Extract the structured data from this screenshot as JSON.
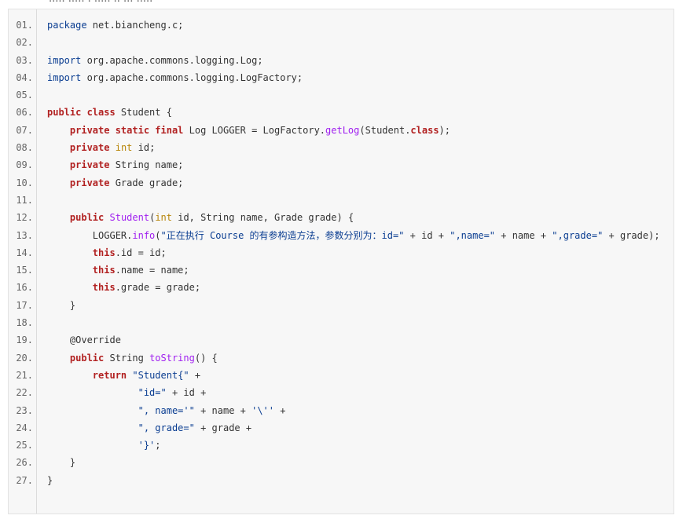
{
  "header": {
    "cut_text": "..... ..... . ..... .. ... ....."
  },
  "code_block": {
    "lines": [
      {
        "number": "01.",
        "tokens": [
          {
            "type": "string",
            "text": "package"
          },
          {
            "type": "plain",
            "text": " net.biancheng.c;"
          }
        ]
      },
      {
        "number": "02.",
        "tokens": [
          {
            "type": "plain",
            "text": ""
          }
        ]
      },
      {
        "number": "03.",
        "tokens": [
          {
            "type": "import",
            "text": "import"
          },
          {
            "type": "plain",
            "text": " org.apache.commons.logging.Log;"
          }
        ]
      },
      {
        "number": "04.",
        "tokens": [
          {
            "type": "import",
            "text": "import"
          },
          {
            "type": "plain",
            "text": " org.apache.commons.logging.LogFactory;"
          }
        ]
      },
      {
        "number": "05.",
        "tokens": [
          {
            "type": "plain",
            "text": ""
          }
        ]
      },
      {
        "number": "06.",
        "tokens": [
          {
            "type": "keyword",
            "text": "public class"
          },
          {
            "type": "plain",
            "text": " Student {"
          }
        ]
      },
      {
        "number": "07.",
        "tokens": [
          {
            "type": "plain",
            "text": "    "
          },
          {
            "type": "keyword",
            "text": "private static final"
          },
          {
            "type": "plain",
            "text": " Log LOGGER = LogFactory."
          },
          {
            "type": "method",
            "text": "getLog"
          },
          {
            "type": "plain",
            "text": "(Student."
          },
          {
            "type": "keyword",
            "text": "class"
          },
          {
            "type": "plain",
            "text": ");"
          }
        ]
      },
      {
        "number": "08.",
        "tokens": [
          {
            "type": "plain",
            "text": "    "
          },
          {
            "type": "keyword",
            "text": "private"
          },
          {
            "type": "plain",
            "text": " "
          },
          {
            "type": "type",
            "text": "int"
          },
          {
            "type": "plain",
            "text": " id;"
          }
        ]
      },
      {
        "number": "09.",
        "tokens": [
          {
            "type": "plain",
            "text": "    "
          },
          {
            "type": "keyword",
            "text": "private"
          },
          {
            "type": "plain",
            "text": " String name;"
          }
        ]
      },
      {
        "number": "10.",
        "tokens": [
          {
            "type": "plain",
            "text": "    "
          },
          {
            "type": "keyword",
            "text": "private"
          },
          {
            "type": "plain",
            "text": " Grade grade;"
          }
        ]
      },
      {
        "number": "11.",
        "tokens": [
          {
            "type": "plain",
            "text": ""
          }
        ]
      },
      {
        "number": "12.",
        "tokens": [
          {
            "type": "plain",
            "text": "    "
          },
          {
            "type": "keyword",
            "text": "public"
          },
          {
            "type": "plain",
            "text": " "
          },
          {
            "type": "method",
            "text": "Student"
          },
          {
            "type": "plain",
            "text": "("
          },
          {
            "type": "type",
            "text": "int"
          },
          {
            "type": "plain",
            "text": " id, String name, Grade grade) {"
          }
        ]
      },
      {
        "number": "13.",
        "tokens": [
          {
            "type": "plain",
            "text": "        LOGGER."
          },
          {
            "type": "method",
            "text": "info"
          },
          {
            "type": "plain",
            "text": "("
          },
          {
            "type": "string",
            "text": "\"正在执行 Course 的有参构造方法，参数分别为：id=\""
          },
          {
            "type": "plain",
            "text": " + id + "
          },
          {
            "type": "string",
            "text": "\",name=\""
          },
          {
            "type": "plain",
            "text": " + name + "
          },
          {
            "type": "string",
            "text": "\",grade=\""
          },
          {
            "type": "plain",
            "text": " + grade);"
          }
        ]
      },
      {
        "number": "14.",
        "tokens": [
          {
            "type": "plain",
            "text": "        "
          },
          {
            "type": "keyword",
            "text": "this"
          },
          {
            "type": "plain",
            "text": ".id = id;"
          }
        ]
      },
      {
        "number": "15.",
        "tokens": [
          {
            "type": "plain",
            "text": "        "
          },
          {
            "type": "keyword",
            "text": "this"
          },
          {
            "type": "plain",
            "text": ".name = name;"
          }
        ]
      },
      {
        "number": "16.",
        "tokens": [
          {
            "type": "plain",
            "text": "        "
          },
          {
            "type": "keyword",
            "text": "this"
          },
          {
            "type": "plain",
            "text": ".grade = grade;"
          }
        ]
      },
      {
        "number": "17.",
        "tokens": [
          {
            "type": "plain",
            "text": "    }"
          }
        ]
      },
      {
        "number": "18.",
        "tokens": [
          {
            "type": "plain",
            "text": ""
          }
        ]
      },
      {
        "number": "19.",
        "tokens": [
          {
            "type": "plain",
            "text": "    "
          },
          {
            "type": "annotation",
            "text": "@Override"
          }
        ]
      },
      {
        "number": "20.",
        "tokens": [
          {
            "type": "plain",
            "text": "    "
          },
          {
            "type": "keyword",
            "text": "public"
          },
          {
            "type": "plain",
            "text": " String "
          },
          {
            "type": "method",
            "text": "toString"
          },
          {
            "type": "plain",
            "text": "() {"
          }
        ]
      },
      {
        "number": "21.",
        "tokens": [
          {
            "type": "plain",
            "text": "        "
          },
          {
            "type": "keyword",
            "text": "return"
          },
          {
            "type": "plain",
            "text": " "
          },
          {
            "type": "string",
            "text": "\"Student{\""
          },
          {
            "type": "plain",
            "text": " +"
          }
        ]
      },
      {
        "number": "22.",
        "tokens": [
          {
            "type": "plain",
            "text": "                "
          },
          {
            "type": "string",
            "text": "\"id=\""
          },
          {
            "type": "plain",
            "text": " + id +"
          }
        ]
      },
      {
        "number": "23.",
        "tokens": [
          {
            "type": "plain",
            "text": "                "
          },
          {
            "type": "string",
            "text": "\", name='\""
          },
          {
            "type": "plain",
            "text": " + name + "
          },
          {
            "type": "string",
            "text": "'\\''"
          },
          {
            "type": "plain",
            "text": " +"
          }
        ]
      },
      {
        "number": "24.",
        "tokens": [
          {
            "type": "plain",
            "text": "                "
          },
          {
            "type": "string",
            "text": "\", grade=\""
          },
          {
            "type": "plain",
            "text": " + grade +"
          }
        ]
      },
      {
        "number": "25.",
        "tokens": [
          {
            "type": "plain",
            "text": "                "
          },
          {
            "type": "string",
            "text": "'}'"
          },
          {
            "type": "plain",
            "text": ";"
          }
        ]
      },
      {
        "number": "26.",
        "tokens": [
          {
            "type": "plain",
            "text": "    }"
          }
        ]
      },
      {
        "number": "27.",
        "tokens": [
          {
            "type": "plain",
            "text": "}"
          }
        ]
      }
    ]
  }
}
